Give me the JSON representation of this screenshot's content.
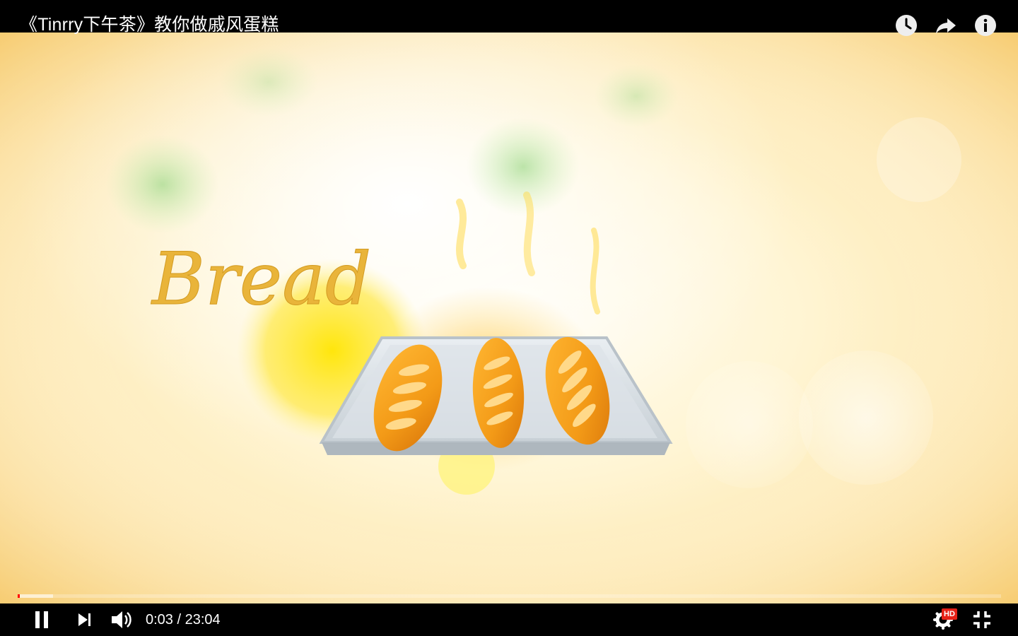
{
  "video": {
    "title": "《Tinrry下午茶》教你做戚风蛋糕",
    "overlay_word": "Bread"
  },
  "top_actions": [
    {
      "name": "watch-later-icon"
    },
    {
      "name": "share-icon"
    },
    {
      "name": "info-icon"
    }
  ],
  "playback": {
    "current_time": "0:03",
    "duration": "23:04",
    "time_display": "0:03 / 23:04",
    "played_fraction": 0.002,
    "buffered_fraction": 0.036
  },
  "controls": {
    "quality_badge": "HD"
  },
  "colors": {
    "progress_played": "#ff0000",
    "hd_badge": "#e62117",
    "bread_text": "#e9b43a"
  }
}
